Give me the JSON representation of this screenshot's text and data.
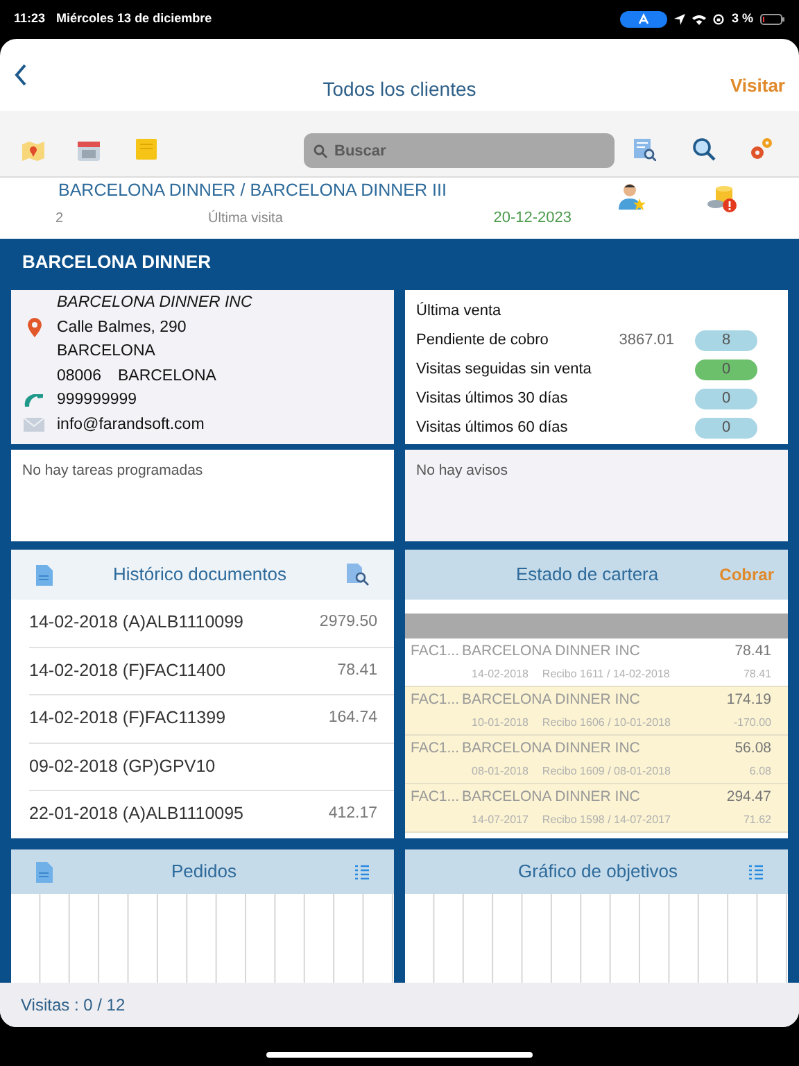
{
  "status_bar": {
    "time": "11:23",
    "date": "Miércoles 13 de diciembre",
    "battery": "3 %"
  },
  "nav": {
    "title": "Todos los clientes",
    "action": "Visitar"
  },
  "search": {
    "placeholder": "Buscar"
  },
  "client": {
    "name": "BARCELONA DINNER  / BARCELONA DINNER III",
    "number": "2",
    "last_visit_label": "Última visita",
    "last_visit_date": "20-12-2023"
  },
  "section_title": "BARCELONA DINNER",
  "contact": {
    "company": "BARCELONA DINNER INC",
    "address": "Calle Balmes, 290",
    "city": "BARCELONA",
    "postal_code": "08006",
    "province": "BARCELONA",
    "phone": "999999999",
    "email": "info@farandsoft.com"
  },
  "stats": [
    {
      "label": "Última venta"
    },
    {
      "label": "Pendiente de cobro",
      "amount": "3867.01",
      "count": "8",
      "color": "#a9d6e5"
    },
    {
      "label": "Visitas seguidas sin venta",
      "count": "0",
      "color": "#6cc06c"
    },
    {
      "label": "Visitas últimos 30 días",
      "count": "0",
      "color": "#a9d6e5"
    },
    {
      "label": "Visitas últimos 60 días",
      "count": "0",
      "color": "#a9d6e5"
    }
  ],
  "tasks": {
    "message": "No hay tareas programadas"
  },
  "alerts": {
    "message": "No hay avisos"
  },
  "documents": {
    "title": "Histórico documentos",
    "rows": [
      {
        "document": "14-02-2018 (A)ALB1110099",
        "amount": "2979.50"
      },
      {
        "document": "14-02-2018 (F)FAC11400",
        "amount": "78.41"
      },
      {
        "document": "14-02-2018 (F)FAC11399",
        "amount": "164.74"
      },
      {
        "document": "09-02-2018 (GP)GPV10"
      },
      {
        "document": "22-01-2018 (A)ALB1110095",
        "amount": "412.17"
      }
    ]
  },
  "portfolio": {
    "title": "Estado de cartera",
    "action": "Cobrar",
    "rows": [
      {
        "invoice": "FAC1...",
        "customer": "BARCELONA DINNER INC",
        "total": "78.41",
        "date": "14-02-2018",
        "receipt": "Recibo 1611 / 14-02-2018",
        "pending": "78.41",
        "highlighted": false
      },
      {
        "invoice": "FAC1...",
        "customer": "BARCELONA DINNER INC",
        "total": "174.19",
        "date": "10-01-2018",
        "receipt": "Recibo 1606 / 10-01-2018",
        "pending": "-170.00",
        "highlighted": true
      },
      {
        "invoice": "FAC1...",
        "customer": "BARCELONA DINNER INC",
        "total": "56.08",
        "date": "08-01-2018",
        "receipt": "Recibo 1609 / 08-01-2018",
        "pending": "6.08",
        "highlighted": true
      },
      {
        "invoice": "FAC1...",
        "customer": "BARCELONA DINNER INC",
        "total": "294.47",
        "date": "14-07-2017",
        "receipt": "Recibo 1598 / 14-07-2017",
        "pending": "71.62",
        "highlighted": true
      }
    ]
  },
  "orders": {
    "title": "Pedidos"
  },
  "objectives": {
    "title": "Gráfico de objetivos"
  },
  "footer": {
    "visits": "Visitas : 0 / 12"
  }
}
